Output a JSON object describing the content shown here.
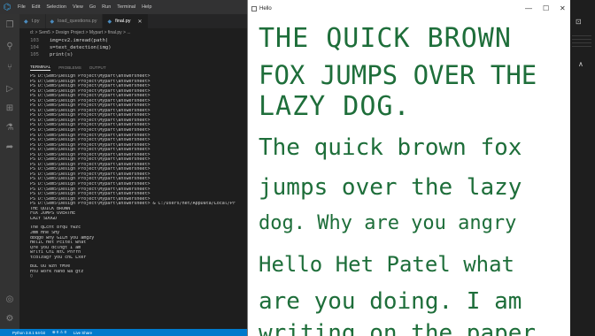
{
  "vscode": {
    "menu": [
      "File",
      "Edit",
      "Selection",
      "View",
      "Go",
      "Run",
      "Terminal",
      "Help"
    ],
    "tabs": [
      {
        "name": "t.py",
        "active": false
      },
      {
        "name": "load_questions.py",
        "active": false
      },
      {
        "name": "final.py",
        "active": true
      }
    ],
    "breadcrumb": "d: > Sem5 > Design Project > Mypart > final.py > ...",
    "code_lines": [
      {
        "num": "103",
        "text": "img=cv2.imread(path)"
      },
      {
        "num": "104",
        "text": "s=text_detection(img)"
      },
      {
        "num": "105",
        "text": "print(s)"
      }
    ],
    "panel_tabs": [
      "TERMINAL",
      "PROBLEMS",
      "OUTPUT"
    ],
    "terminal_prompts": [
      "PS D:\\Sem5\\Design Project\\Mypart\\answersheet>",
      "PS D:\\Sem5\\Design Project\\Mypart\\answersheet>",
      "PS D:\\Sem5\\Design Project\\Mypart\\answersheet>",
      "PS D:\\Sem5\\Design Project\\Mypart\\answersheet>",
      "PS D:\\Sem5\\Design Project\\Mypart\\answersheet>",
      "PS D:\\Sem5\\Design Project\\Mypart\\answersheet>",
      "PS D:\\Sem5\\Design Project\\Mypart\\answersheet>",
      "PS D:\\Sem5\\Design Project\\Mypart\\answersheet>",
      "PS D:\\Sem5\\Design Project\\Mypart\\answersheet>",
      "PS D:\\Sem5\\Design Project\\Mypart\\answersheet>",
      "PS D:\\Sem5\\Design Project\\Mypart\\answersheet>",
      "PS D:\\Sem5\\Design Project\\Mypart\\answersheet>",
      "PS D:\\Sem5\\Design Project\\Mypart\\answersheet>",
      "PS D:\\Sem5\\Design Project\\Mypart\\answersheet>",
      "PS D:\\Sem5\\Design Project\\Mypart\\answersheet>",
      "PS D:\\Sem5\\Design Project\\Mypart\\answersheet>",
      "PS D:\\Sem5\\Design Project\\Mypart\\answersheet>",
      "PS D:\\Sem5\\Design Project\\Mypart\\answersheet>",
      "PS D:\\Sem5\\Design Project\\Mypart\\answersheet>",
      "PS D:\\Sem5\\Design Project\\Mypart\\answersheet>",
      "PS D:\\Sem5\\Design Project\\Mypart\\answersheet>",
      "PS D:\\Sem5\\Design Project\\Mypart\\answersheet>",
      "PS D:\\Sem5\\Design Project\\Mypart\\answersheet>",
      "PS D:\\Sem5\\Design Project\\Mypart\\answersheet>",
      "PS D:\\Sem5\\Design Project\\Mypart\\answersheet>",
      "PS D:\\Sem5\\Design Project\\Mypart\\answersheet>",
      "PS D:\\Sem5\\Design Project\\Mypart\\answersheet> & C:/Users/het/AppData/Local/Pr"
    ],
    "output_block1": [
      "THE QUICK BROWN",
      "FOX JUMPS OVERTHE",
      "LAZY SDOGD"
    ],
    "output_block2": [
      "The qLcht brqu fwzc",
      "Jmm Hne SHy",
      "dbqg0 why GILH you amgzy",
      "HelIC Het Pcitel what",
      "Qre you dclngt I am",
      "wrlfi Ch1 NtC Pnrrn",
      "tcdlzagr you chL Lxer"
    ],
    "output_block3": [
      "BuL Ou wzn fMVe",
      "HtU work hand wa gtz"
    ],
    "cursor": "▯",
    "status": [
      "Python 3.8.1 64-bit",
      "⊗ 0 ⚠ 0",
      "Live Share"
    ]
  },
  "hello_window": {
    "title": "Hello",
    "controls": [
      "—",
      "☐",
      "✕"
    ],
    "lines": [
      "THE QUICK BROWN",
      "FOX JUMPS OVER THE",
      "LAZY DOG.",
      "The quick brown fox",
      "jumps over the lazy",
      "dog. Why are you angry",
      "Hello Het Patel what",
      "are you doing. I am",
      "writing on the paper"
    ],
    "ink_color": "#1e6e3a"
  },
  "right_strip": {
    "buttons": [
      "⊡",
      "∧"
    ]
  }
}
